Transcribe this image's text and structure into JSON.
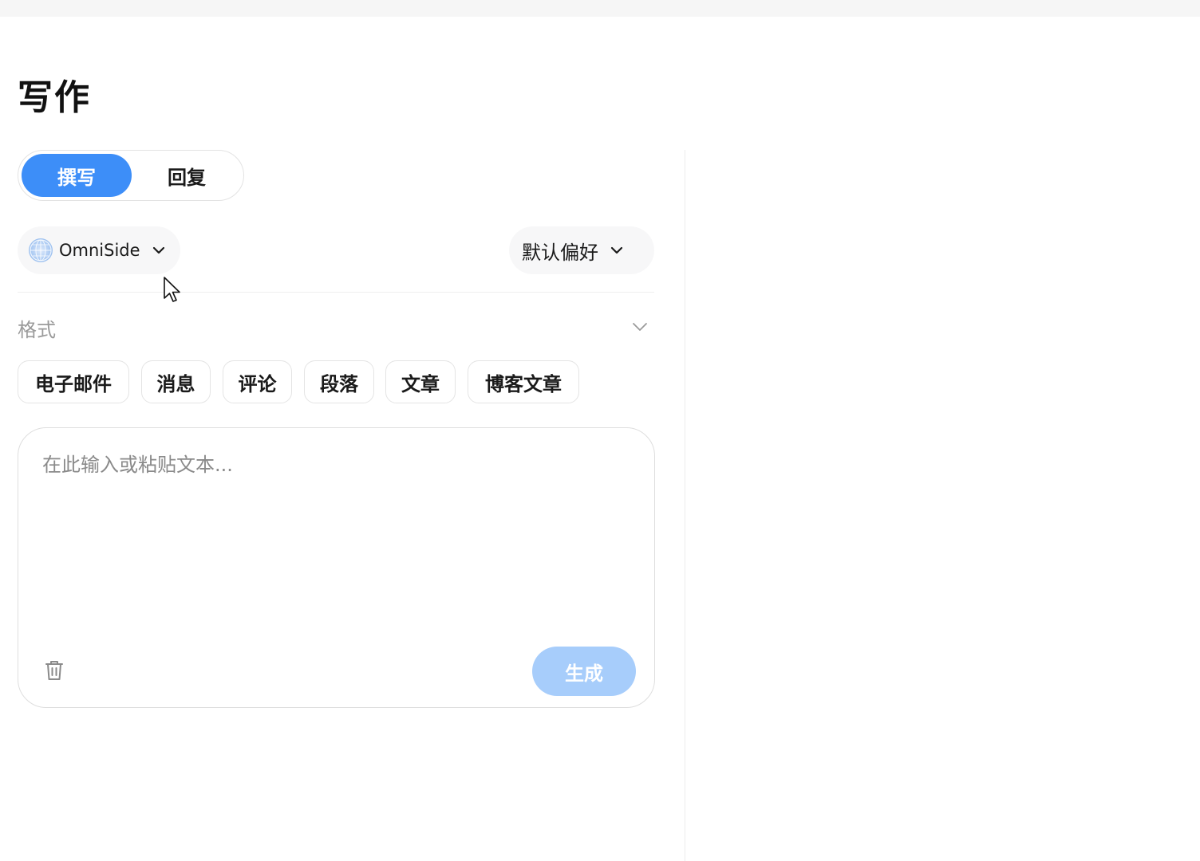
{
  "page": {
    "title": "写作"
  },
  "mode_toggle": {
    "tabs": [
      {
        "label": "撰写",
        "active": true
      },
      {
        "label": "回复",
        "active": false
      }
    ]
  },
  "source_selector": {
    "label": "OmniSide",
    "icon": "globe-icon"
  },
  "preference_selector": {
    "label": "默认偏好"
  },
  "format": {
    "label": "格式",
    "options": [
      "电子邮件",
      "消息",
      "评论",
      "段落",
      "文章",
      "博客文章"
    ]
  },
  "editor": {
    "value": "",
    "placeholder": "在此输入或粘贴文本...",
    "generate_label": "生成"
  },
  "colors": {
    "accent": "#3d8ef8",
    "accent_disabled": "#a7cdfb",
    "muted_text": "#9a9a9a"
  }
}
